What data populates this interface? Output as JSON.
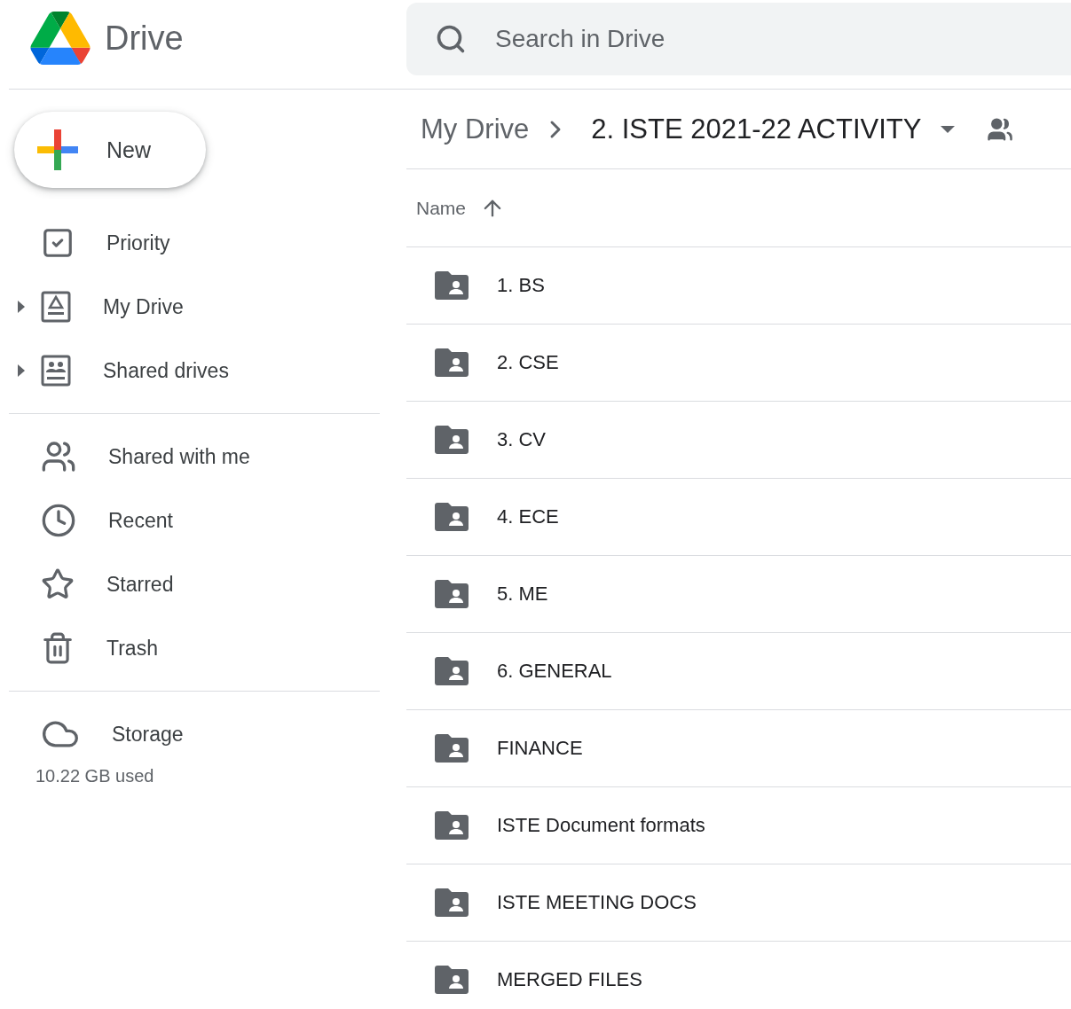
{
  "app": {
    "name": "Drive"
  },
  "search": {
    "placeholder": "Search in Drive"
  },
  "new_button": {
    "label": "New"
  },
  "sidebar": {
    "groups": [
      {
        "items": [
          {
            "label": "Priority",
            "kind": "priority"
          },
          {
            "label": "My Drive",
            "kind": "my-drive",
            "expanded": false
          },
          {
            "label": "Shared drives",
            "kind": "shared-drives",
            "expanded": false
          }
        ]
      },
      {
        "items": [
          {
            "label": "Shared with me",
            "kind": "shared"
          },
          {
            "label": "Recent",
            "kind": "recent"
          },
          {
            "label": "Starred",
            "kind": "starred"
          },
          {
            "label": "Trash",
            "kind": "trash"
          }
        ]
      },
      {
        "items": [
          {
            "label": "Storage",
            "kind": "storage"
          }
        ]
      }
    ],
    "storage_used": "10.22 GB used"
  },
  "breadcrumb": {
    "parent": "My Drive",
    "current": "2. ISTE 2021-22 ACTIVITY"
  },
  "table": {
    "sort_column": "Name",
    "sort_ascending": true,
    "rows": [
      {
        "name": "1. BS"
      },
      {
        "name": "2. CSE"
      },
      {
        "name": "3. CV"
      },
      {
        "name": "4. ECE"
      },
      {
        "name": "5. ME"
      },
      {
        "name": "6. GENERAL"
      },
      {
        "name": "FINANCE"
      },
      {
        "name": "ISTE Document formats"
      },
      {
        "name": "ISTE MEETING DOCS"
      },
      {
        "name": "MERGED FILES"
      }
    ]
  }
}
